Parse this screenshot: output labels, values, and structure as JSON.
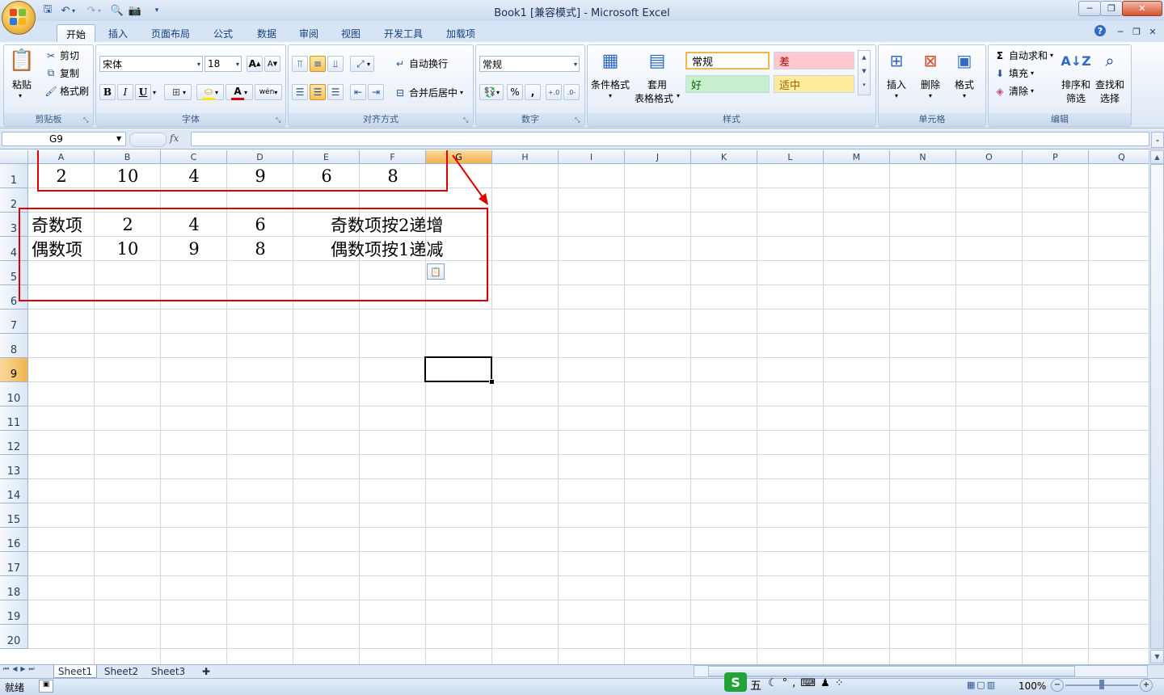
{
  "window": {
    "title": "Book1  [兼容模式] - Microsoft Excel",
    "controls": [
      "─",
      "❐",
      "✕"
    ],
    "inner_controls": [
      "─",
      "❐",
      "✕"
    ]
  },
  "tabs": [
    "开始",
    "插入",
    "页面布局",
    "公式",
    "数据",
    "审阅",
    "视图",
    "开发工具",
    "加载项"
  ],
  "ribbon": {
    "clipboard": {
      "label": "剪贴板",
      "paste": "粘贴",
      "cut": "剪切",
      "copy": "复制",
      "format_painter": "格式刷"
    },
    "font": {
      "label": "字体",
      "name": "宋体",
      "size": "18",
      "bold": "B",
      "italic": "I",
      "underline": "U",
      "grow": "A",
      "shrink": "A",
      "wen": "wén"
    },
    "alignment": {
      "label": "对齐方式",
      "wrap": "自动换行",
      "merge": "合并后居中"
    },
    "number": {
      "label": "数字",
      "format": "常规",
      "percent": "%",
      "comma": ",",
      "inc_decimal": "⁺.0\n.00",
      "dec_decimal": ".00\n⁻.0"
    },
    "styles": {
      "label": "样式",
      "conditional": "条件格式",
      "table_format_1": "套用",
      "table_format_2": "表格格式",
      "normal": "常规",
      "bad": "差",
      "good": "好",
      "neutral": "适中"
    },
    "cells": {
      "label": "单元格",
      "insert": "插入",
      "delete": "删除",
      "format": "格式"
    },
    "editing": {
      "label": "编辑",
      "autosum": "自动求和",
      "fill": "填充",
      "clear": "清除",
      "sort_1": "排序和",
      "sort_2": "筛选",
      "find_1": "查找和",
      "find_2": "选择"
    }
  },
  "formula_bar": {
    "name_box": "G9",
    "fx": "fx",
    "content": ""
  },
  "columns": [
    "A",
    "B",
    "C",
    "D",
    "E",
    "F",
    "G",
    "H",
    "I",
    "J",
    "K",
    "L",
    "M",
    "N",
    "O",
    "P",
    "Q"
  ],
  "rows": [
    "1",
    "2",
    "3",
    "4",
    "5",
    "6",
    "7",
    "8",
    "9",
    "10",
    "11",
    "12",
    "13",
    "14",
    "15",
    "16",
    "17",
    "18",
    "19",
    "20"
  ],
  "cells": {
    "row1": [
      "2",
      "10",
      "4",
      "9",
      "6",
      "8"
    ],
    "row3": {
      "label": "奇数项",
      "values": [
        "2",
        "4",
        "6"
      ],
      "note": "奇数项按2递增"
    },
    "row4": {
      "label": "偶数项",
      "values": [
        "10",
        "9",
        "8"
      ],
      "note": "偶数项按1递减"
    }
  },
  "sheets": [
    "Sheet1",
    "Sheet2",
    "Sheet3"
  ],
  "status": {
    "ready": "就绪",
    "zoom": "100%",
    "ime": "五"
  },
  "colors": {
    "annotation_red": "#e00000",
    "selected_header": "#f1b44e",
    "grid_line": "#d0d7e5"
  }
}
